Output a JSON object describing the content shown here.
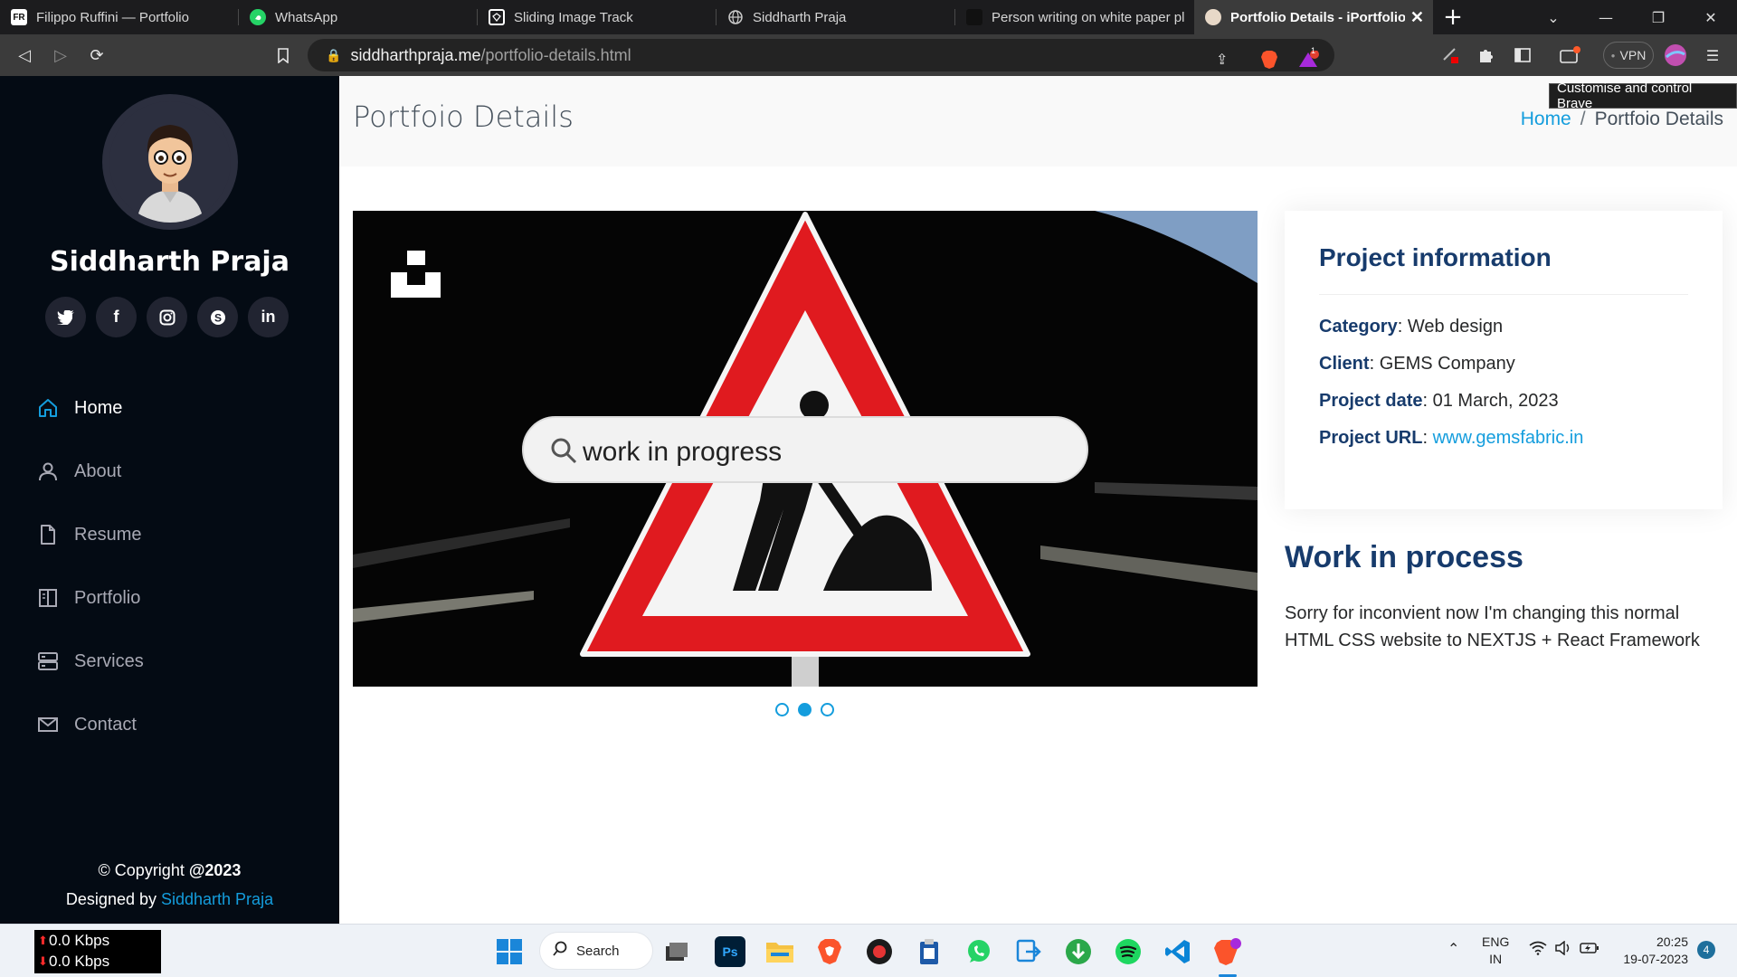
{
  "browser": {
    "tabs": [
      {
        "title": "Filippo Ruffini — Portfolio",
        "favicon": "FR"
      },
      {
        "title": "WhatsApp",
        "favicon": "whatsapp-icon"
      },
      {
        "title": "Sliding Image Track",
        "favicon": "codepen-icon"
      },
      {
        "title": "Siddharth Praja",
        "favicon": "globe-icon"
      },
      {
        "title": "Person writing on white paper pl",
        "favicon": "photo-icon"
      },
      {
        "title": "Portfolio Details - iPortfolio",
        "favicon": "avatar-icon",
        "active": true
      }
    ],
    "new_tab": "+",
    "url_host": "siddharthpraja.me",
    "url_path": "/portfolio-details.html",
    "vpn_label": "VPN",
    "notification_count": "1",
    "tooltip": "Customise and control Brave"
  },
  "sidebar": {
    "name": "Siddharth Praja",
    "social": [
      "twitter",
      "facebook",
      "instagram",
      "skype",
      "linkedin"
    ],
    "nav": [
      {
        "label": "Home",
        "icon": "house-icon",
        "active": true
      },
      {
        "label": "About",
        "icon": "person-icon"
      },
      {
        "label": "Resume",
        "icon": "file-icon"
      },
      {
        "label": "Portfolio",
        "icon": "book-icon"
      },
      {
        "label": "Services",
        "icon": "server-icon"
      },
      {
        "label": "Contact",
        "icon": "envelope-icon"
      }
    ],
    "copyright_prefix": "© Copyright ",
    "copyright_year": "@2023",
    "designed_by": "Designed by ",
    "designer": "Siddharth Praja"
  },
  "main": {
    "page_title": "Portfoio Details",
    "breadcrumb": {
      "home": "Home",
      "separator": "/",
      "current": "Portfoio Details"
    },
    "slider": {
      "image_text": "work in progress",
      "slide_count": 3,
      "active_slide": 2
    },
    "info": {
      "title": "Project information",
      "category_label": "Category",
      "category": "Web design",
      "client_label": "Client",
      "client": "GEMS Company",
      "date_label": "Project date",
      "date": "01 March, 2023",
      "url_label": "Project URL",
      "url": "www.gemsfabric.in"
    },
    "desc_title": "Work in process",
    "desc_text": "Sorry for inconvient now I'm changing this normal HTML CSS website to NEXTJS + React Framework"
  },
  "taskbar": {
    "net_up": "0.0 Kbps",
    "net_down": "0.0 Kbps",
    "search_label": "Search",
    "lang_top": "ENG",
    "lang_bottom": "IN",
    "time": "20:25",
    "date": "19-07-2023",
    "notifications": "4"
  },
  "colors": {
    "accent": "#149ddd",
    "sidebar_bg": "#040b14",
    "heading": "#173b6c"
  }
}
